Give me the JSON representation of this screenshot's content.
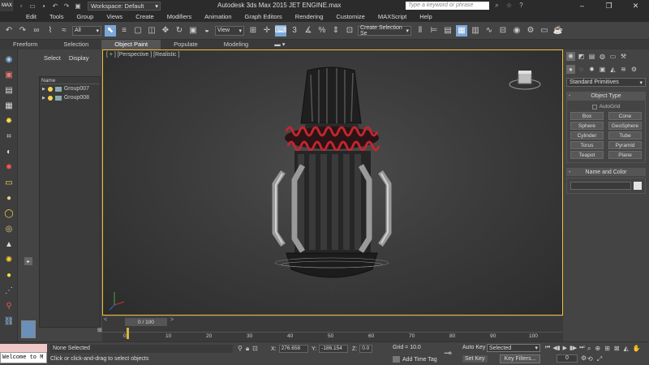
{
  "titlebar": {
    "logo": "MAX",
    "quick_access_icons": [
      "new-icon",
      "open-icon",
      "save-icon",
      "undo-icon",
      "redo-icon",
      "project-icon"
    ],
    "workspace": "Workspace: Default",
    "window_title": "Autodesk 3ds Max  2015      JET ENGINE.max",
    "search_placeholder": "Type a keyword or phrase",
    "window_controls": [
      "minimize-icon",
      "restore-icon",
      "close-icon"
    ]
  },
  "menu": [
    "Edit",
    "Tools",
    "Group",
    "Views",
    "Create",
    "Modifiers",
    "Animation",
    "Graph Editors",
    "Rendering",
    "Customize",
    "MAXScript",
    "Help"
  ],
  "toolbar": {
    "selection_filter": "All",
    "reference_coord": "View",
    "named_selection": "Create Selection Se"
  },
  "ribbon": {
    "tabs": [
      "Freeform",
      "Selection",
      "Object Paint",
      "Populate",
      "Modeling"
    ],
    "active": "Object Paint"
  },
  "explorer": {
    "tabs": [
      "Select",
      "Display"
    ],
    "column_header": "Name",
    "rows": [
      {
        "name": "Group007"
      },
      {
        "name": "Group008"
      }
    ]
  },
  "viewport": {
    "label": "[ + ] [Perspective ] [Realistic ]"
  },
  "command_panel": {
    "category": "Standard Primitives",
    "object_type_title": "Object Type",
    "autogrid": "AutoGrid",
    "buttons": [
      "Box",
      "Cone",
      "Sphere",
      "GeoSphere",
      "Cylinder",
      "Tube",
      "Torus",
      "Pyramid",
      "Teapot",
      "Plane"
    ],
    "name_color_title": "Name and Color",
    "object_color": "#e4e4e4"
  },
  "timeline": {
    "slider_label": "0 / 100",
    "ticks": [
      "0",
      "10",
      "20",
      "30",
      "40",
      "50",
      "60",
      "70",
      "80",
      "90",
      "100"
    ]
  },
  "status": {
    "listener_text": "Welcome to M",
    "selection": "None Selected",
    "prompt": "Click or click-and-drag to select objects",
    "x_label": "X:",
    "x_value": "276.658",
    "y_label": "Y:",
    "y_value": "-186.154",
    "z_label": "Z:",
    "z_value": "0.0",
    "grid": "Grid = 10.0",
    "add_time_tag": "Add Time Tag",
    "auto_key": "Auto Key",
    "set_key": "Set Key",
    "key_mode": "Selected",
    "key_filters": "Key Filters...",
    "current_frame": "0"
  },
  "colors": {
    "viewport_border": "#f3c037",
    "accent_blue": "#7aa7d8",
    "engine_red": "#c3262f"
  }
}
